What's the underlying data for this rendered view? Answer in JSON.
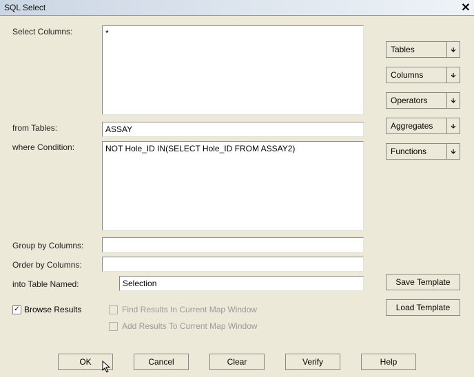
{
  "window": {
    "title": "SQL Select"
  },
  "labels": {
    "select_columns": "Select Columns:",
    "from_tables": "from Tables:",
    "where_condition": "where Condition:",
    "group_by": "Group by Columns:",
    "order_by": "Order by Columns:",
    "into_table": "into Table Named:"
  },
  "fields": {
    "select_columns": "*",
    "from_tables": "ASSAY",
    "where_condition": "NOT Hole_ID IN(SELECT Hole_ID FROM ASSAY2)",
    "group_by": "",
    "order_by": "",
    "into_table": "Selection"
  },
  "dropdowns": {
    "tables": "Tables",
    "columns": "Columns",
    "operators": "Operators",
    "aggregates": "Aggregates",
    "functions": "Functions"
  },
  "side_buttons": {
    "save_template": "Save Template",
    "load_template": "Load Template"
  },
  "checkboxes": {
    "browse_results": {
      "label": "Browse Results",
      "checked": true
    },
    "find_in_map": {
      "label": "Find Results In Current Map Window",
      "checked": false,
      "disabled": true
    },
    "add_to_map": {
      "label": "Add Results To Current Map Window",
      "checked": false,
      "disabled": true
    }
  },
  "buttons": {
    "ok": "OK",
    "cancel": "Cancel",
    "clear": "Clear",
    "verify": "Verify",
    "help": "Help"
  }
}
